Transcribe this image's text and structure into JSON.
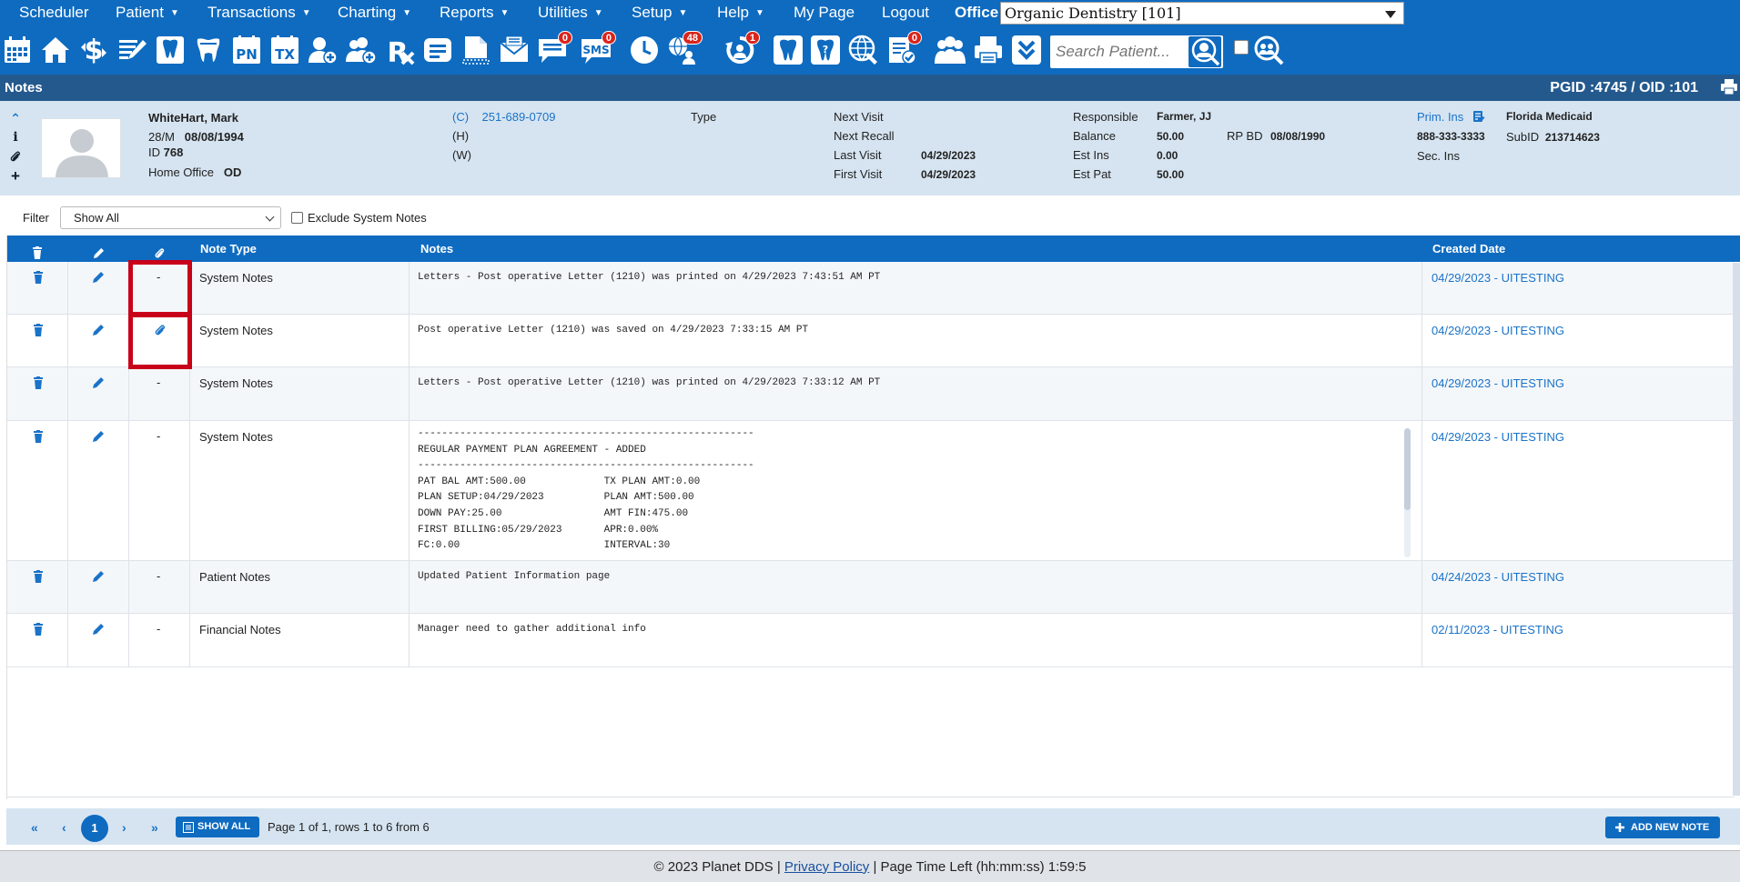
{
  "menu": {
    "items": [
      {
        "label": "Scheduler",
        "caret": ""
      },
      {
        "label": "Patient",
        "caret": "▼"
      },
      {
        "label": "Transactions",
        "caret": "▼"
      },
      {
        "label": "Charting",
        "caret": "▼"
      },
      {
        "label": "Reports",
        "caret": "▼"
      },
      {
        "label": "Utilities",
        "caret": "▼"
      },
      {
        "label": "Setup",
        "caret": "▼"
      },
      {
        "label": "Help",
        "caret": "▼"
      },
      {
        "label": "My Page",
        "caret": ""
      },
      {
        "label": "Logout",
        "caret": ""
      }
    ],
    "office_label": "Office",
    "office_value": "Organic Dentistry [101]"
  },
  "toolbar": {
    "badges": {
      "messages": "0",
      "sms": "0",
      "web": "48",
      "recall": "1",
      "forms": "0"
    },
    "search_placeholder": "Search Patient..."
  },
  "notes_bar": {
    "title": "Notes",
    "pgid_oid": "PGID :4745  /  OID :101"
  },
  "patient": {
    "name": "WhiteHart, Mark",
    "age_sex": "28/M",
    "dob": "08/08/1994",
    "id_label": "ID",
    "id": "768",
    "home_office_label": "Home Office",
    "home_office": "OD",
    "phone_cell_label": "(C)",
    "phone_cell": "251-689-0709",
    "phone_home_label": "(H)",
    "phone_work_label": "(W)",
    "type_label": "Type",
    "next_visit_label": "Next Visit",
    "next_recall_label": "Next Recall",
    "last_visit_label": "Last Visit",
    "last_visit": "04/29/2023",
    "first_visit_label": "First Visit",
    "first_visit": "04/29/2023",
    "responsible_label": "Responsible",
    "responsible": "Farmer, JJ",
    "balance_label": "Balance",
    "balance": "50.00",
    "rp_bd_label": "RP BD",
    "rp_bd": "08/08/1990",
    "est_ins_label": "Est Ins",
    "est_ins": "0.00",
    "est_pat_label": "Est Pat",
    "est_pat": "50.00",
    "prim_ins_label": "Prim. Ins",
    "prim_ins": "Florida Medicaid",
    "ins_phone": "888-333-3333",
    "subid_label": "SubID",
    "subid": "213714623",
    "sec_ins_label": "Sec. Ins"
  },
  "filter": {
    "label": "Filter",
    "value": "Show All",
    "exclude_label": "Exclude System Notes"
  },
  "table": {
    "headers": {
      "note_type": "Note Type",
      "notes": "Notes",
      "created_date": "Created Date"
    },
    "rows": [
      {
        "attach": "-",
        "note_type": "System Notes",
        "notes": "Letters - Post operative Letter (1210) was printed on 4/29/2023 7:43:51 AM PT",
        "created": "04/29/2023 - UITESTING"
      },
      {
        "attach": "paperclip",
        "note_type": "System Notes",
        "notes": "Post operative Letter (1210) was saved on 4/29/2023 7:33:15 AM PT",
        "created": "04/29/2023 - UITESTING"
      },
      {
        "attach": "-",
        "note_type": "System Notes",
        "notes": "Letters - Post operative Letter (1210) was printed on 4/29/2023 7:33:12 AM PT",
        "created": "04/29/2023 - UITESTING"
      },
      {
        "attach": "-",
        "note_type": "System Notes",
        "notes": "--------------------------------------------------------\nREGULAR PAYMENT PLAN AGREEMENT - ADDED\n--------------------------------------------------------\nPAT BAL AMT:500.00             TX PLAN AMT:0.00\nPLAN SETUP:04/29/2023          PLAN AMT:500.00\nDOWN PAY:25.00                 AMT FIN:475.00\nFIRST BILLING:05/29/2023       APR:0.00%\nFC:0.00                        INTERVAL:30",
        "created": "04/29/2023 - UITESTING"
      },
      {
        "attach": "-",
        "note_type": "Patient Notes",
        "notes": "Updated Patient Information page",
        "created": "04/24/2023 - UITESTING"
      },
      {
        "attach": "-",
        "note_type": "Financial Notes",
        "notes": "Manager need to gather additional info",
        "created": "02/11/2023 - UITESTING"
      }
    ]
  },
  "pager": {
    "current_page": "1",
    "show_all": "SHOW ALL",
    "info": "Page 1 of 1, rows 1 to 6 from 6",
    "add_new_note": "ADD NEW NOTE"
  },
  "footer": {
    "copyright": "© 2023 Planet DDS |",
    "privacy": "Privacy Policy",
    "time_left": "|  Page Time Left (hh:mm:ss) 1:59:5"
  },
  "colors": {
    "primary": "#0e6bc0",
    "header_dark": "#24598e",
    "patient_bg": "#d6e4f1",
    "highlight": "#c8001a",
    "link": "#1a73c8"
  }
}
